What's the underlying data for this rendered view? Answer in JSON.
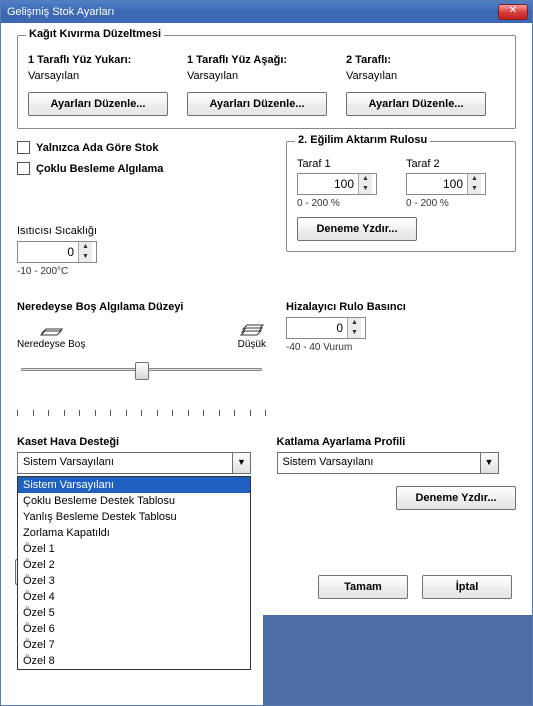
{
  "window": {
    "title": "Gelişmiş Stok Ayarları"
  },
  "curl": {
    "legend": "Kağıt Kıvırma Düzeltmesi",
    "cols": [
      {
        "header": "1 Taraflı Yüz Yukarı:",
        "value": "Varsayılan",
        "button": "Ayarları Düzenle..."
      },
      {
        "header": "1 Taraflı Yüz Aşağı:",
        "value": "Varsayılan",
        "button": "Ayarları Düzenle..."
      },
      {
        "header": "2 Taraflı:",
        "value": "Varsayılan",
        "button": "Ayarları Düzenle..."
      }
    ]
  },
  "checks": {
    "name_only": "Yalnızca Ada Göre Stok",
    "multifeed": "Çoklu Besleme Algılama"
  },
  "transfer": {
    "legend": "2. Eğilim Aktarım Rulosu",
    "side1_label": "Taraf 1",
    "side1_value": "100",
    "side1_range": "0 - 200 %",
    "side2_label": "Taraf 2",
    "side2_value": "100",
    "side2_range": "0 - 200 %",
    "test_print": "Deneme Yzdır..."
  },
  "fuser": {
    "label": "Isıtıcısı Sıcaklığı",
    "value": "0",
    "range": "-10 - 200°C"
  },
  "almost_empty": {
    "label": "Neredeyse Boş Algılama Düzeyi",
    "left_caption": "Neredeyse Boş",
    "right_caption": "Düşük"
  },
  "aligner": {
    "label": "Hizalayıcı Rulo Basıncı",
    "value": "0",
    "range": "-40 - 40 Vurum"
  },
  "tray_air": {
    "label": "Kaset Hava Desteği",
    "selected": "Sistem Varsayılanı",
    "options": [
      "Sistem Varsayılanı",
      "Çoklu Besleme Destek Tablosu",
      "Yanlış Besleme Destek Tablosu",
      "Zorlama Kapatıldı",
      "Özel 1",
      "Özel 2",
      "Özel 3",
      "Özel 4",
      "Özel 5",
      "Özel 6",
      "Özel 7",
      "Özel 8"
    ]
  },
  "fold": {
    "label": "Katlama Ayarlama Profili",
    "selected": "Sistem Varsayılanı",
    "test_print": "Deneme Yzdır..."
  },
  "buttons": {
    "ok": "Tamam",
    "cancel": "İptal"
  }
}
